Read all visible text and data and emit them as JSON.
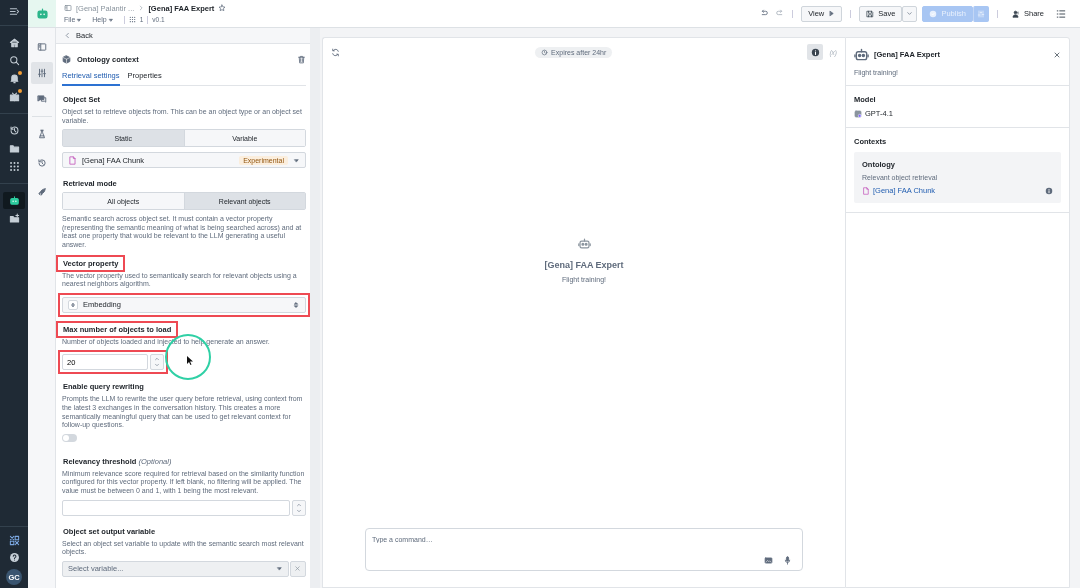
{
  "main_rail": {
    "items": [
      {
        "selected": false,
        "notification": false
      },
      {
        "selected": false,
        "notification": false
      },
      {
        "selected": false,
        "notification": true
      },
      {
        "selected": false,
        "notification": true
      },
      {
        "selected": false,
        "notification": false
      },
      {
        "selected": false,
        "notification": false
      },
      {
        "selected": false,
        "notification": false
      },
      {
        "selected": true,
        "notification": false
      },
      {
        "selected": false,
        "notification": false
      }
    ],
    "avatar": "GC"
  },
  "top_bar": {
    "breadcrumb_parent": "[Gena] Palantir ...",
    "title": "[Gena] FAA Expert",
    "starred": false,
    "menus": [
      "File",
      "Help"
    ],
    "count": "1",
    "version": "v0.1",
    "view_button": "View",
    "save_button": "Save",
    "publish_button": {
      "label": "Publish",
      "disabled": true
    },
    "share_button": "Share"
  },
  "tool_rail": {
    "items": [
      {
        "selected": false
      },
      {
        "selected": true
      },
      {
        "selected": false
      },
      {
        "selected": false
      },
      {
        "selected": false
      },
      {
        "selected": false
      }
    ]
  },
  "settings": {
    "back": "Back",
    "title": "Ontology context",
    "tabs": [
      {
        "label": "Retrieval settings",
        "selected": true
      },
      {
        "label": "Properties",
        "selected": false
      }
    ],
    "object_set": {
      "label": "Object Set",
      "description": "Object set to retrieve objects from. This can be an object type or an object set variable.",
      "segments": [
        {
          "label": "Static",
          "selected": true
        },
        {
          "label": "Variable",
          "selected": false
        }
      ],
      "value": "[Gena] FAA Chunk",
      "badge": "Experimental"
    },
    "retrieval_mode": {
      "label": "Retrieval mode",
      "segments": [
        {
          "label": "All objects",
          "selected": false
        },
        {
          "label": "Relevant objects",
          "selected": true
        }
      ],
      "description": "Semantic search across object set. It must contain a vector property (representing the semantic meaning of what is being searched across) and at least one property that would be relevant to the LLM generating a useful answer."
    },
    "vector_property": {
      "label": "Vector property",
      "label_highlighted": true,
      "description": "The vector property used to semantically search for relevant objects using a nearest neighbors algorithm.",
      "value": "Embedding",
      "field_highlighted": true
    },
    "max_objects": {
      "label": "Max number of objects to load",
      "label_highlighted": true,
      "description": "Number of objects loaded and injected to help generate an answer.",
      "value": "20",
      "field_highlighted": true
    },
    "query_rewriting": {
      "label": "Enable query rewriting",
      "description": "Prompts the LLM to rewrite the user query before retrieval, using context from the latest 3 exchanges in the conversation history. This creates a more semantically meaningful query that can be used to get relevant context for follow-up questions.",
      "on": false
    },
    "relevancy": {
      "label": "Relevancy threshold",
      "optional": "(Optional)",
      "description": "Minimum relevance score required for retrieval based on the similarity function configured for this vector property. If left blank, no filtering will be applied. The value must be between 0 and 1, with 1 being the most relevant."
    },
    "output_variable": {
      "label": "Object set output variable",
      "description": "Select an object set variable to update with the semantic search most relevant objects.",
      "placeholder": "Select variable..."
    }
  },
  "chat": {
    "expires": "Expires after 24hr",
    "variables": "(x)",
    "agent_name": "[Gena] FAA Expert",
    "agent_description": "Flight training!",
    "command_placeholder": "Type a command…"
  },
  "details": {
    "name": "[Gena] FAA Expert",
    "description": "Flight training!",
    "model_label": "Model",
    "model": "GPT-4.1",
    "contexts_label": "Contexts",
    "context": {
      "title": "Ontology",
      "subtitle": "Relevant object retrieval",
      "link": "[Gena] FAA Chunk"
    }
  }
}
